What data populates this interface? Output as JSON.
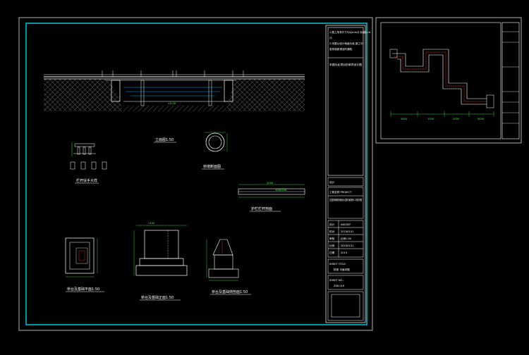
{
  "colors": {
    "background": "#000000",
    "outer_border": "#b0b0b0",
    "inner_border": "#00c8d8",
    "lines": "#ffffff",
    "dimension": "#44ff44",
    "accent_red": "#ff3030",
    "water": "#00aaff"
  },
  "views": {
    "elevation_title": "立面图1:50",
    "pipe_section_title": "桥墩断面图",
    "rail_detail_title": "栏杆扶手大样",
    "guardrail_title": "护栏栏杆剖面",
    "pier_plan_title": "桥台及基础平面1:50",
    "pier_front_title": "桥台及基础正面1:50",
    "pier_side_title": "桥台及基础侧剖面1:50"
  },
  "dimensions": {
    "guardrail_top": "2000",
    "guardrail_mid": "100X200",
    "pier_width": "1100"
  },
  "notes_panel": {
    "lines": [
      "1.图上所有尺寸均以mm计,标高以m",
      "计.",
      "2.本图以设计地面为准,施工中",
      "若有误差请及时通知."
    ],
    "sub_note": "本图为此项目的单项设计图"
  },
  "title_block": {
    "project_label": "工程名称 PROJECT:",
    "project_value": "生态园林景观河道设计(整体)景观桥1:1桥梁详图",
    "designer_label": "设计",
    "checker_label": "校对",
    "approver_label": "审核",
    "scale_label": "比例",
    "date_label": "日期",
    "sheet_title_label": "SHEET TITLE:",
    "sheet_title_value": "桥梁 平面详图",
    "sheet_no_label": "SHEET NO.:",
    "sheet_no_value": "ZS6-019",
    "values": [
      "ABCDEF",
      "20230101",
      "比例1:50",
      "20230101",
      "2019"
    ]
  },
  "plan_sheet": {
    "dims": [
      "3400",
      "1500",
      "2000",
      "3000"
    ]
  }
}
